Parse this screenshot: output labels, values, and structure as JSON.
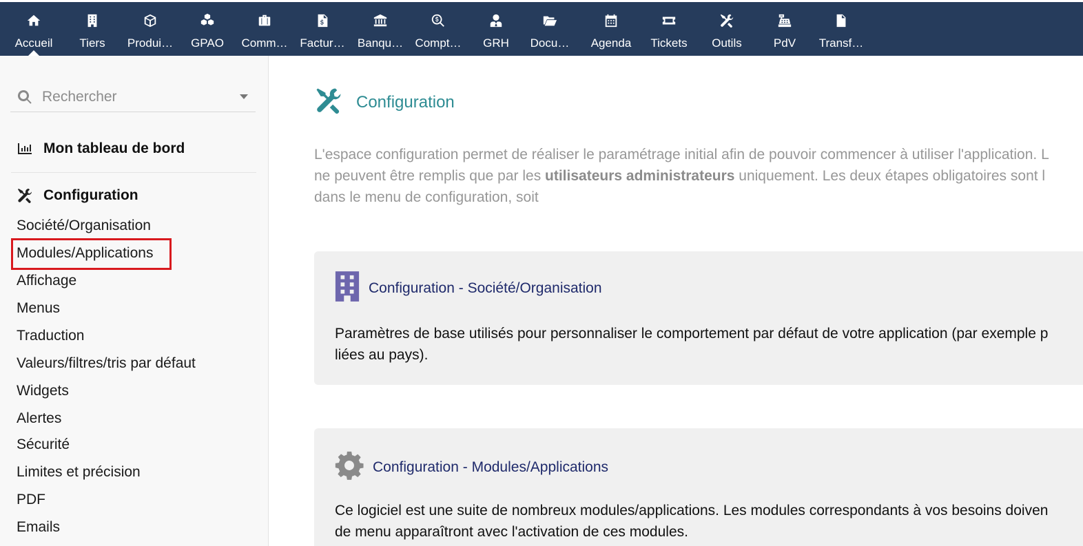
{
  "nav": {
    "items": [
      {
        "label": "Accueil",
        "icon": "home-icon"
      },
      {
        "label": "Tiers",
        "icon": "building-icon"
      },
      {
        "label": "Produi…",
        "icon": "cube-icon"
      },
      {
        "label": "GPAO",
        "icon": "cubes-icon"
      },
      {
        "label": "Comm…",
        "icon": "suitcase-icon"
      },
      {
        "label": "Factur…",
        "icon": "invoice-icon"
      },
      {
        "label": "Banqu…",
        "icon": "bank-icon"
      },
      {
        "label": "Compt…",
        "icon": "search-dollar-icon"
      },
      {
        "label": "GRH",
        "icon": "user-tie-icon"
      },
      {
        "label": "Docu…",
        "icon": "folder-open-icon"
      },
      {
        "label": "Agenda",
        "icon": "calendar-icon"
      },
      {
        "label": "Tickets",
        "icon": "ticket-icon"
      },
      {
        "label": "Outils",
        "icon": "tools-icon"
      },
      {
        "label": "PdV",
        "icon": "cash-register-icon"
      },
      {
        "label": "Transf…",
        "icon": "file-icon"
      }
    ],
    "active": "Accueil",
    "bg_color": "#263c5c"
  },
  "sidebar": {
    "search_placeholder": "Rechercher",
    "dashboard_label": "Mon tableau de bord",
    "config_label": "Configuration",
    "links": [
      "Société/Organisation",
      "Modules/Applications",
      "Affichage",
      "Menus",
      "Traduction",
      "Valeurs/filtres/tris par défaut",
      "Widgets",
      "Alertes",
      "Sécurité",
      "Limites et précision",
      "PDF",
      "Emails"
    ],
    "highlighted": "Modules/Applications"
  },
  "main": {
    "title": "Configuration",
    "intro_line1": "L'espace configuration permet de réaliser le paramétrage initial afin de pouvoir commencer à utiliser l'application. L",
    "intro_line2_before": "ne peuvent être remplis que par les ",
    "intro_line2_bold": "utilisateurs administrateurs",
    "intro_line2_after": " uniquement. Les deux étapes obligatoires sont l",
    "intro_line3": "dans le menu de configuration, soit",
    "cards": [
      {
        "title": "Configuration - Société/Organisation",
        "icon": "building-icon",
        "line1": "Paramètres de base utilisés pour personnaliser le comportement par défaut de votre application (par exemple p",
        "line2": "liées au pays)."
      },
      {
        "title": "Configuration - Modules/Applications",
        "icon": "gear-icon",
        "line1": "Ce logiciel est une suite de nombreux modules/applications. Les modules correspondants à vos besoins doiven",
        "line2": "de menu apparaîtront avec l'activation de ces modules."
      }
    ]
  },
  "colors": {
    "accent": "#2e8c93",
    "card_title": "#1f2a6b",
    "highlight": "#d8191e"
  }
}
